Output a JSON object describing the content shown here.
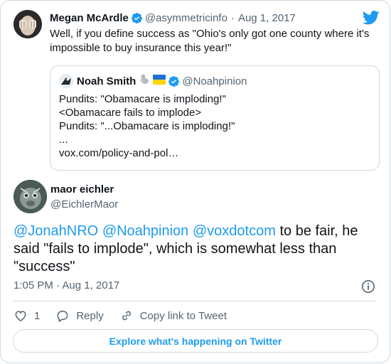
{
  "colors": {
    "accent": "#1d9bf0",
    "text": "#0f1419",
    "muted": "#536471",
    "border": "#cfd9de"
  },
  "parent_tweet": {
    "author_name": "Megan McArdle",
    "author_handle": "@asymmetricinfo",
    "separator": "·",
    "date": "Aug 1, 2017",
    "text": "Well, if you define success as \"Ohio's only got one county where it's impossible to buy insurance this year!\"",
    "icons": [
      "verified-icon",
      "twitter-bird-icon"
    ],
    "quoted_tweet": {
      "author_name": "Noah Smith",
      "emoji": [
        "rabbit-emoji",
        "ukraine-flag-emoji"
      ],
      "author_handle": "@Noahpinion",
      "lines": [
        "Pundits: \"Obamacare is imploding!\"",
        "<Obamacare fails to implode>",
        "Pundits: \"...Obamacare is imploding!\"",
        "...",
        "vox.com/policy-and-pol…"
      ]
    }
  },
  "main_tweet": {
    "author_name": "maor eichler",
    "author_handle": "@EichlerMaor",
    "mentions": [
      "@JonahNRO",
      "@Noahpinion",
      "@voxdotcom"
    ],
    "text": "to be fair, he said \"fails to implode\", which is somewhat less than \"success\"",
    "timestamp": "1:05 PM · Aug 1, 2017",
    "actions": {
      "like_count": "1",
      "reply_label": "Reply",
      "copy_link_label": "Copy link to Tweet"
    }
  },
  "explore_label": "Explore what's happening on Twitter"
}
